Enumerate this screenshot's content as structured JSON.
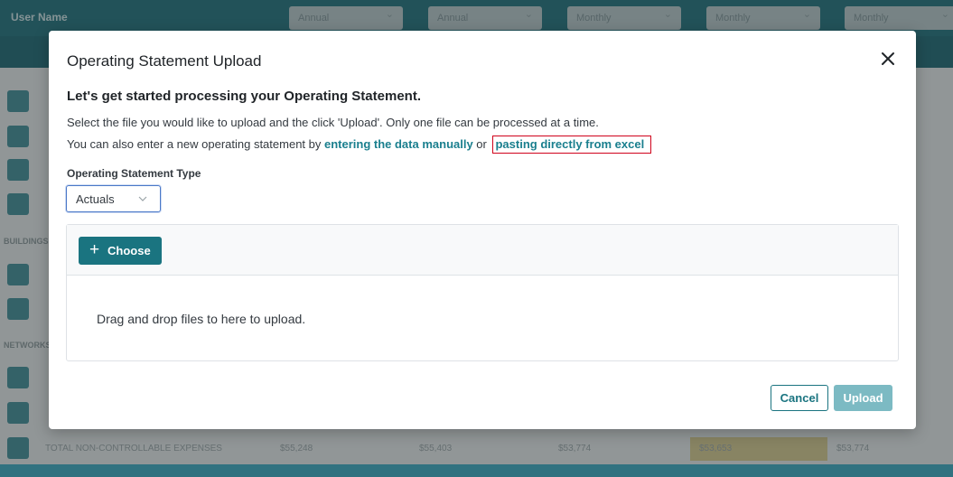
{
  "background": {
    "app_title": "User Name",
    "dropdowns": [
      "Annual",
      "Annual",
      "Monthly",
      "Monthly",
      "Monthly"
    ],
    "section_labels": [
      "BUILDINGS",
      "NETWORKS"
    ],
    "bottom_row": {
      "label": "TOTAL NON-CONTROLLABLE EXPENSES",
      "cells": [
        "$55,248",
        "$55,403",
        "$53,774",
        "$53,653",
        "$53,774"
      ]
    }
  },
  "modal": {
    "title": "Operating Statement Upload",
    "heading": "Let's get started processing your Operating Statement.",
    "description_line1": "Select the file you would like to upload and the click 'Upload'. Only one file can be processed at a time.",
    "description_line2_prefix": "You can also enter a new operating statement by ",
    "manual_link": "entering the data manually",
    "connector": " or ",
    "excel_link": "pasting directly from excel",
    "type_label": "Operating Statement Type",
    "type_value": "Actuals",
    "choose_label": "Choose",
    "drop_text": "Drag and drop files to here to upload.",
    "cancel_label": "Cancel",
    "upload_label": "Upload"
  },
  "icons": {
    "close": "close-icon",
    "chevron": "chevron-down-icon",
    "plus": "plus-icon"
  },
  "colors": {
    "accent": "#1a7480",
    "link": "#1a7f8e",
    "upload_disabled": "#7cbac3",
    "highlight_border": "#d0021b"
  }
}
